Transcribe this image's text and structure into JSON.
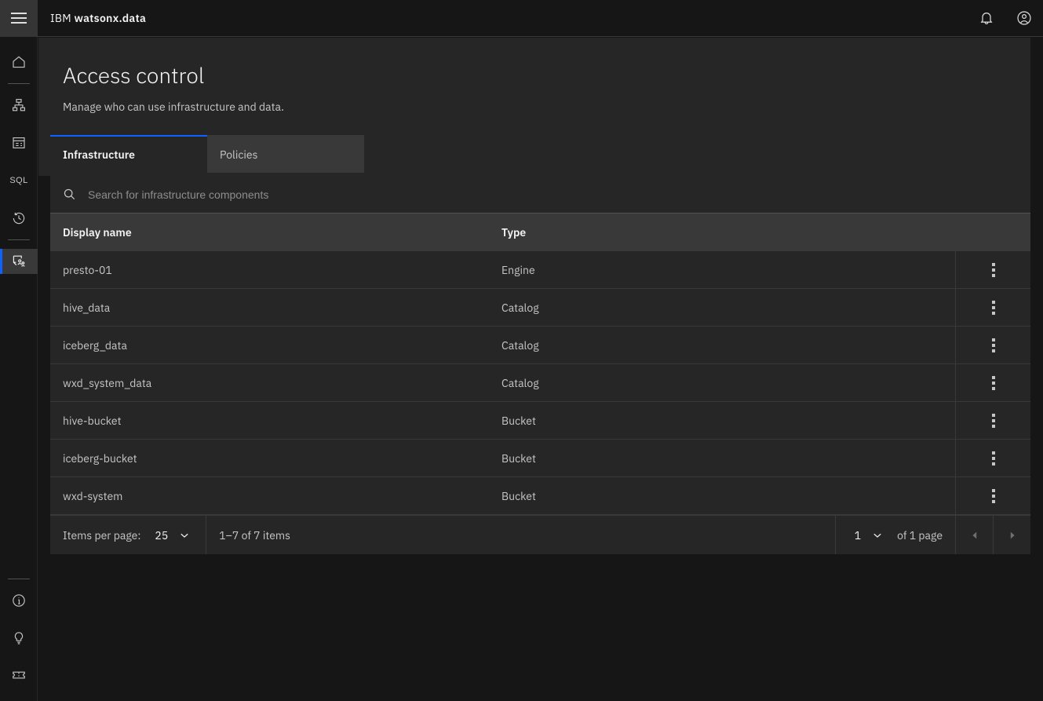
{
  "header": {
    "menu_icon": "hamburger-menu-icon",
    "brand_prefix": "IBM",
    "brand_name": "watsonx.data",
    "notifications_icon": "notification-bell-icon",
    "account_icon": "user-avatar-icon"
  },
  "sidebar": {
    "top_items": [
      {
        "name": "home",
        "icon": "home-icon",
        "label": "Home",
        "selected": false
      },
      {
        "name": "infrastructure-manager",
        "icon": "infrastructure-hierarchy-icon",
        "label": "Infrastructure manager",
        "selected": false
      },
      {
        "name": "data-manager",
        "icon": "data-table-icon",
        "label": "Data manager",
        "selected": false
      },
      {
        "name": "query-workspace",
        "icon": "sql-icon",
        "label": "SQL",
        "selected": false
      },
      {
        "name": "query-history",
        "icon": "history-clock-icon",
        "label": "Query history",
        "selected": false
      },
      {
        "name": "access-control",
        "icon": "access-control-shield-user-icon",
        "label": "Access control",
        "selected": true
      }
    ],
    "bottom_items": [
      {
        "name": "information",
        "icon": "information-icon",
        "label": "Information"
      },
      {
        "name": "whats-new",
        "icon": "lightbulb-icon",
        "label": "What's new"
      },
      {
        "name": "support",
        "icon": "ticket-support-icon",
        "label": "Support"
      }
    ]
  },
  "page": {
    "title": "Access control",
    "subtitle": "Manage who can use infrastructure and data."
  },
  "tabs": [
    {
      "label": "Infrastructure",
      "active": true
    },
    {
      "label": "Policies",
      "active": false
    }
  ],
  "search": {
    "placeholder": "Search for infrastructure components",
    "value": "",
    "icon": "search-icon"
  },
  "table": {
    "columns": [
      "Display name",
      "Type"
    ],
    "rows": [
      {
        "display_name": "presto-01",
        "type": "Engine"
      },
      {
        "display_name": "hive_data",
        "type": "Catalog"
      },
      {
        "display_name": "iceberg_data",
        "type": "Catalog"
      },
      {
        "display_name": "wxd_system_data",
        "type": "Catalog"
      },
      {
        "display_name": "hive-bucket",
        "type": "Bucket"
      },
      {
        "display_name": "iceberg-bucket",
        "type": "Bucket"
      },
      {
        "display_name": "wxd-system",
        "type": "Bucket"
      }
    ],
    "row_menu_icon": "overflow-menu-vertical-icon"
  },
  "pagination": {
    "items_per_page_label": "Items per page:",
    "items_per_page_value": "25",
    "range_text": "1–7 of 7 items",
    "current_page": "1",
    "of_pages_text": "of 1 page",
    "prev_icon": "caret-left-icon",
    "next_icon": "caret-right-icon"
  },
  "colors": {
    "accent": "#0f62fe",
    "page_background": "#161616",
    "panel": "#262626",
    "header_row": "#393939",
    "text_primary": "#f4f4f4",
    "text_secondary": "#c6c6c6",
    "placeholder": "#8d8d8d"
  }
}
